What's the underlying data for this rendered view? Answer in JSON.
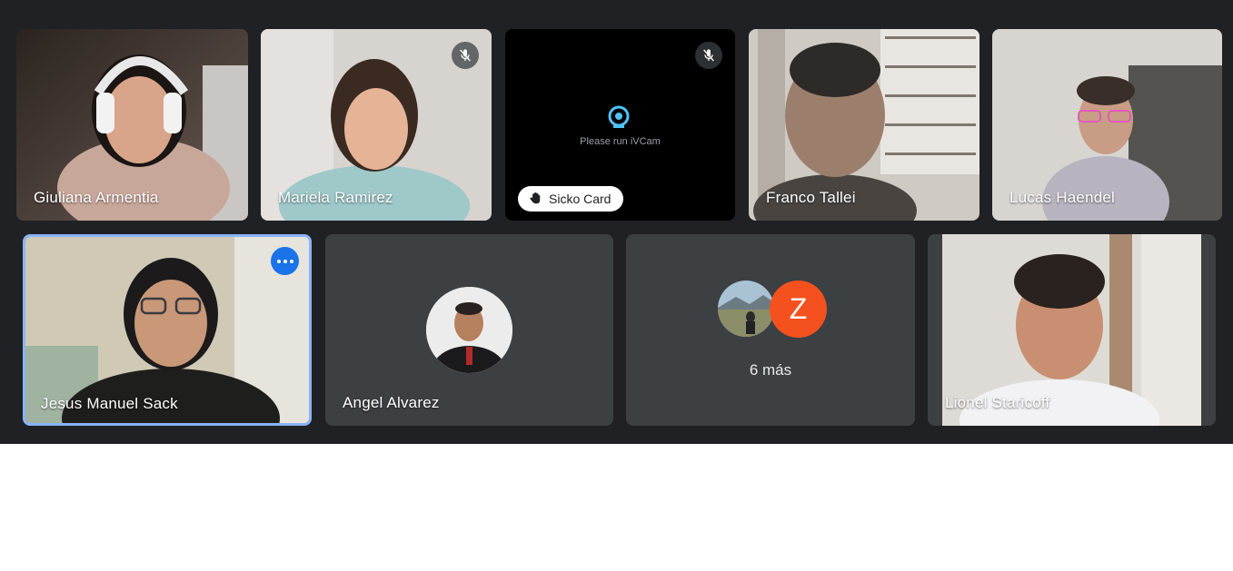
{
  "participants": {
    "p1": {
      "name": "Giuliana Armentia"
    },
    "p2": {
      "name": "Mariela Ramirez"
    },
    "p3": {
      "name": "Sicko Card",
      "screen_text": "Please run iVCam"
    },
    "p4": {
      "name": "Franco Tallei"
    },
    "p5": {
      "name": "Lucas Haendel"
    },
    "p6": {
      "name": "Jesus Manuel Sack"
    },
    "p7": {
      "name": "Angel Alvarez"
    },
    "p8": {
      "avatar_letter": "Z",
      "more_label": "6 más"
    },
    "p9": {
      "name": "Lionel Staricoff"
    }
  },
  "colors": {
    "background": "#202124",
    "tile": "#3c4043",
    "active_border": "#8ab4f8",
    "menu_button": "#1a73e8",
    "avatar_z": "#f4511e",
    "ivcam_icon": "#4fc3f7"
  },
  "icons": [
    "mic-off-icon",
    "raised-hand-icon",
    "more-options-icon",
    "webcam-icon"
  ]
}
